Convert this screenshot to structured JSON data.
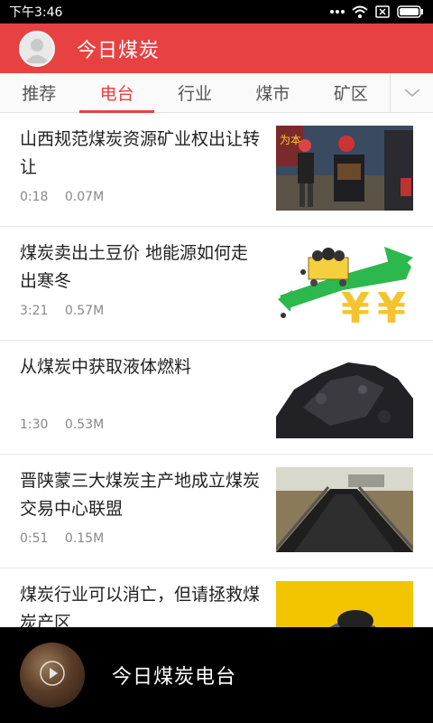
{
  "status_bar": {
    "time": "下午3:46",
    "icons": [
      "more-dots-icon",
      "wifi-icon",
      "no-sim-icon",
      "battery-icon"
    ]
  },
  "header": {
    "title": "今日煤炭",
    "avatar_icon": "user-avatar-icon",
    "background_color": "#e84141"
  },
  "tabs": {
    "items": [
      {
        "label": "推荐",
        "active": false
      },
      {
        "label": "电台",
        "active": true
      },
      {
        "label": "行业",
        "active": false
      },
      {
        "label": "煤市",
        "active": false
      },
      {
        "label": "矿区",
        "active": false
      }
    ],
    "more_icon": "chevron-down-icon",
    "active_color": "#e84141"
  },
  "items": [
    {
      "title": "山西规范煤炭资源矿业权出让转让",
      "duration": "0:18",
      "size": "0.07M",
      "thumb": "miners-photo"
    },
    {
      "title": "煤炭卖出土豆价 地能源如何走出寒冬",
      "duration": "3:21",
      "size": "0.57M",
      "thumb": "coal-money-illustration"
    },
    {
      "title": "从煤炭中获取液体燃料",
      "duration": "1:30",
      "size": "0.53M",
      "thumb": "coal-pile-photo"
    },
    {
      "title": "晋陕蒙三大煤炭主产地成立煤炭交易中心联盟",
      "duration": "0:51",
      "size": "0.15M",
      "thumb": "coal-conveyor-photo"
    },
    {
      "title": "煤炭行业可以消亡，但请拯救煤炭产区",
      "duration": "",
      "size": "",
      "thumb": "coal-in-hands-photo"
    }
  ],
  "player": {
    "title": "今日煤炭电台",
    "play_icon": "play-icon"
  }
}
